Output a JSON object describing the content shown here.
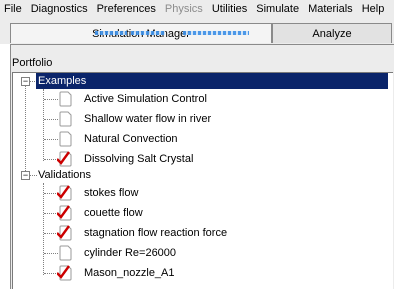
{
  "menubar": {
    "items": [
      {
        "label": "File",
        "enabled": true
      },
      {
        "label": "Diagnostics",
        "enabled": true
      },
      {
        "label": "Preferences",
        "enabled": true
      },
      {
        "label": "Physics",
        "enabled": false
      },
      {
        "label": "Utilities",
        "enabled": true
      },
      {
        "label": "Simulate",
        "enabled": true
      },
      {
        "label": "Materials",
        "enabled": true
      },
      {
        "label": "Help",
        "enabled": true
      }
    ]
  },
  "tabs": {
    "active_label": "Simulation Manager",
    "inactive_label": "Analyze"
  },
  "portfolio": {
    "label": "Portfolio",
    "groups": [
      {
        "label": "Examples",
        "expander": "−",
        "selected": true,
        "items": [
          {
            "label": "Active Simulation Control",
            "checked": false
          },
          {
            "label": "Shallow water flow in river",
            "checked": false
          },
          {
            "label": "Natural Convection",
            "checked": false
          },
          {
            "label": "Dissolving Salt Crystal",
            "checked": true
          }
        ]
      },
      {
        "label": "Validations",
        "expander": "−",
        "selected": false,
        "items": [
          {
            "label": "stokes flow",
            "checked": true
          },
          {
            "label": "couette flow",
            "checked": true
          },
          {
            "label": "stagnation flow reaction force",
            "checked": true
          },
          {
            "label": "cylinder Re=26000",
            "checked": false
          },
          {
            "label": "Mason_nozzle_A1",
            "checked": true
          }
        ]
      }
    ]
  },
  "colors": {
    "selection": "#0a246a",
    "checkmark": "#cc0000",
    "chrome": "#ececec"
  }
}
